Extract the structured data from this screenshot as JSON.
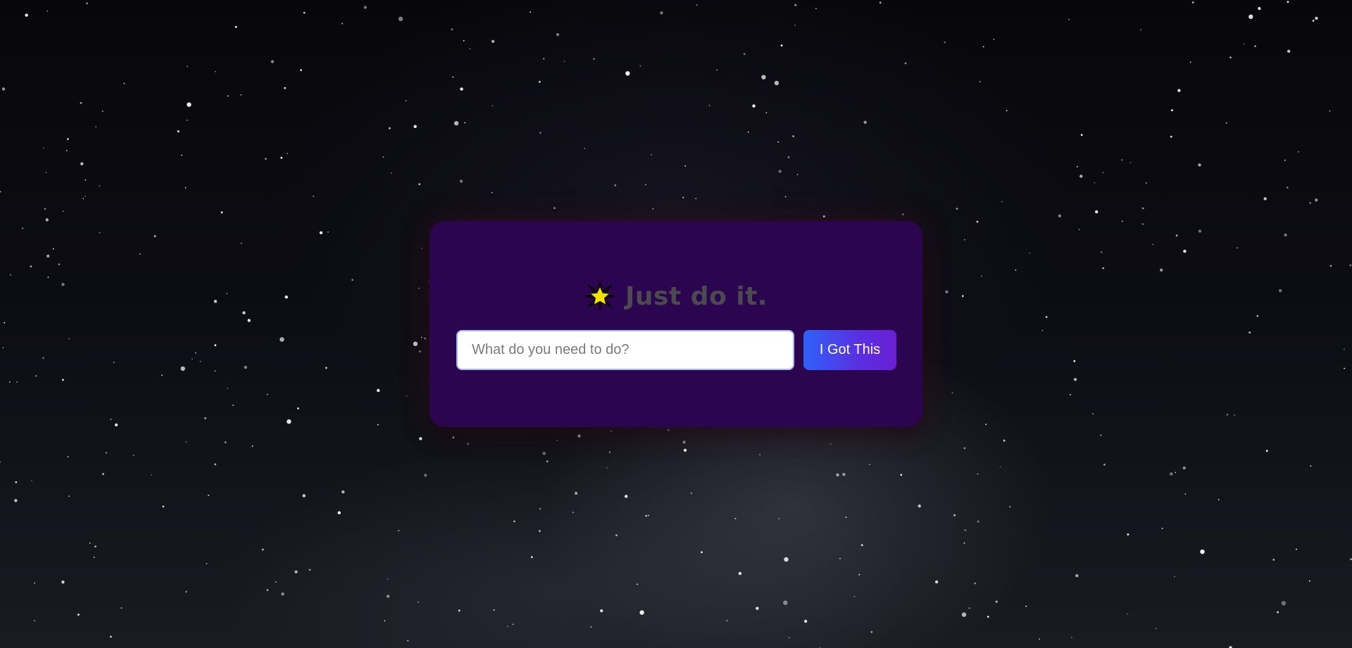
{
  "app": {
    "heading": {
      "icon": "star-icon",
      "title": "Just do it."
    },
    "task_form": {
      "input_value": "",
      "input_placeholder": "What do you need to do?",
      "submit_label": "I Got This"
    }
  },
  "colors": {
    "card_background": "#2c0550",
    "title_text": "#4a4a4f",
    "button_gradient_start": "#2f62f8",
    "button_gradient_end": "#6a1fd2",
    "star_fill": "#f5e100",
    "input_border": "#a9b7f2"
  }
}
